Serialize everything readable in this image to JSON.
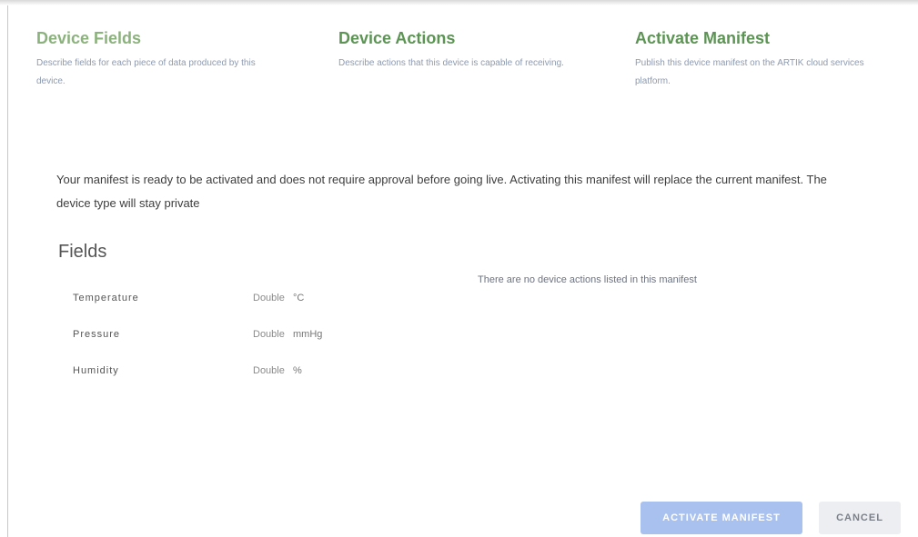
{
  "steps": [
    {
      "title": "Device Fields",
      "description": "Describe fields for each piece of data produced by this device."
    },
    {
      "title": "Device Actions",
      "description": "Describe actions that this device is capable of receiving."
    },
    {
      "title": "Activate Manifest",
      "description": "Publish this device manifest on the ARTIK cloud services platform."
    }
  ],
  "message": "Your manifest is ready to be activated and does not require approval before going live. Activating this manifest will replace the current manifest. The device type will stay private",
  "fields": {
    "heading": "Fields",
    "rows": [
      {
        "name": "Temperature",
        "type": "Double",
        "unit": "°C"
      },
      {
        "name": "Pressure",
        "type": "Double",
        "unit": "mmHg"
      },
      {
        "name": "Humidity",
        "type": "Double",
        "unit": "%"
      }
    ]
  },
  "actions": {
    "empty_text": "There are no device actions listed in this manifest"
  },
  "buttons": {
    "activate": "ACTIVATE MANIFEST",
    "cancel": "CANCEL"
  },
  "colors": {
    "step_title": "#5c9454",
    "primary_button": "#a8c1ee",
    "secondary_button": "#eceef2"
  }
}
